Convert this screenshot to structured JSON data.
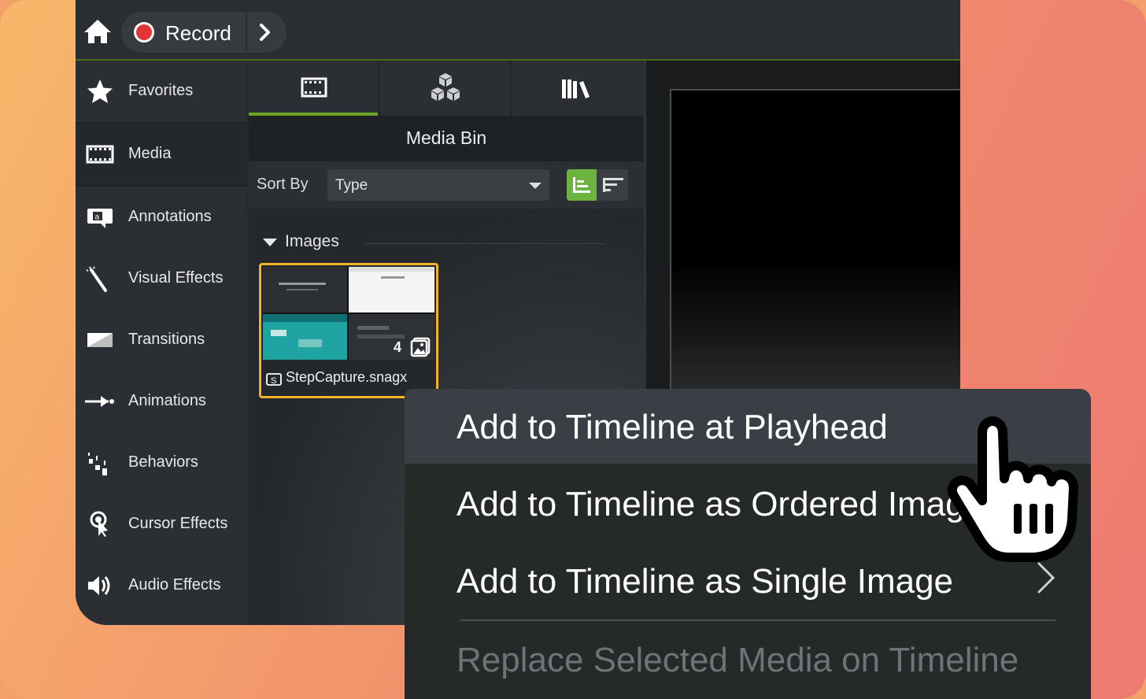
{
  "topbar": {
    "home_icon": "home-icon",
    "record_label": "Record",
    "record_color": "#e23636",
    "more_icon": "chevron-right-icon"
  },
  "sidebar": {
    "items": [
      {
        "label": "Favorites",
        "icon": "star-icon"
      },
      {
        "label": "Media",
        "icon": "film-strip-icon",
        "active": true
      },
      {
        "label": "Annotations",
        "icon": "annotation-icon"
      },
      {
        "label": "Visual Effects",
        "icon": "magic-wand-icon"
      },
      {
        "label": "Transitions",
        "icon": "transition-icon"
      },
      {
        "label": "Animations",
        "icon": "animation-arrow-icon"
      },
      {
        "label": "Behaviors",
        "icon": "behaviors-icon"
      },
      {
        "label": "Cursor Effects",
        "icon": "cursor-effect-icon"
      },
      {
        "label": "Audio Effects",
        "icon": "speaker-icon"
      }
    ]
  },
  "media_panel": {
    "tabs": [
      {
        "icon": "film-strip-icon",
        "active": true
      },
      {
        "icon": "cubes-library-icon"
      },
      {
        "icon": "books-library-icon"
      }
    ],
    "title": "Media Bin",
    "sort_label": "Sort By",
    "sort_value": "Type",
    "accent": "#6db33f",
    "group": {
      "label": "Images"
    },
    "item": {
      "name": "StepCapture.snagx",
      "count": "4",
      "border_color": "#f0b429"
    }
  },
  "context_menu": {
    "items": [
      {
        "label": "Add to Timeline at Playhead",
        "highlighted": true
      },
      {
        "label": "Add to Timeline as Ordered Images"
      },
      {
        "label": "Add to Timeline as Single Image",
        "submenu": true
      },
      {
        "label": "Replace Selected Media on Timeline",
        "disabled": true
      }
    ]
  }
}
